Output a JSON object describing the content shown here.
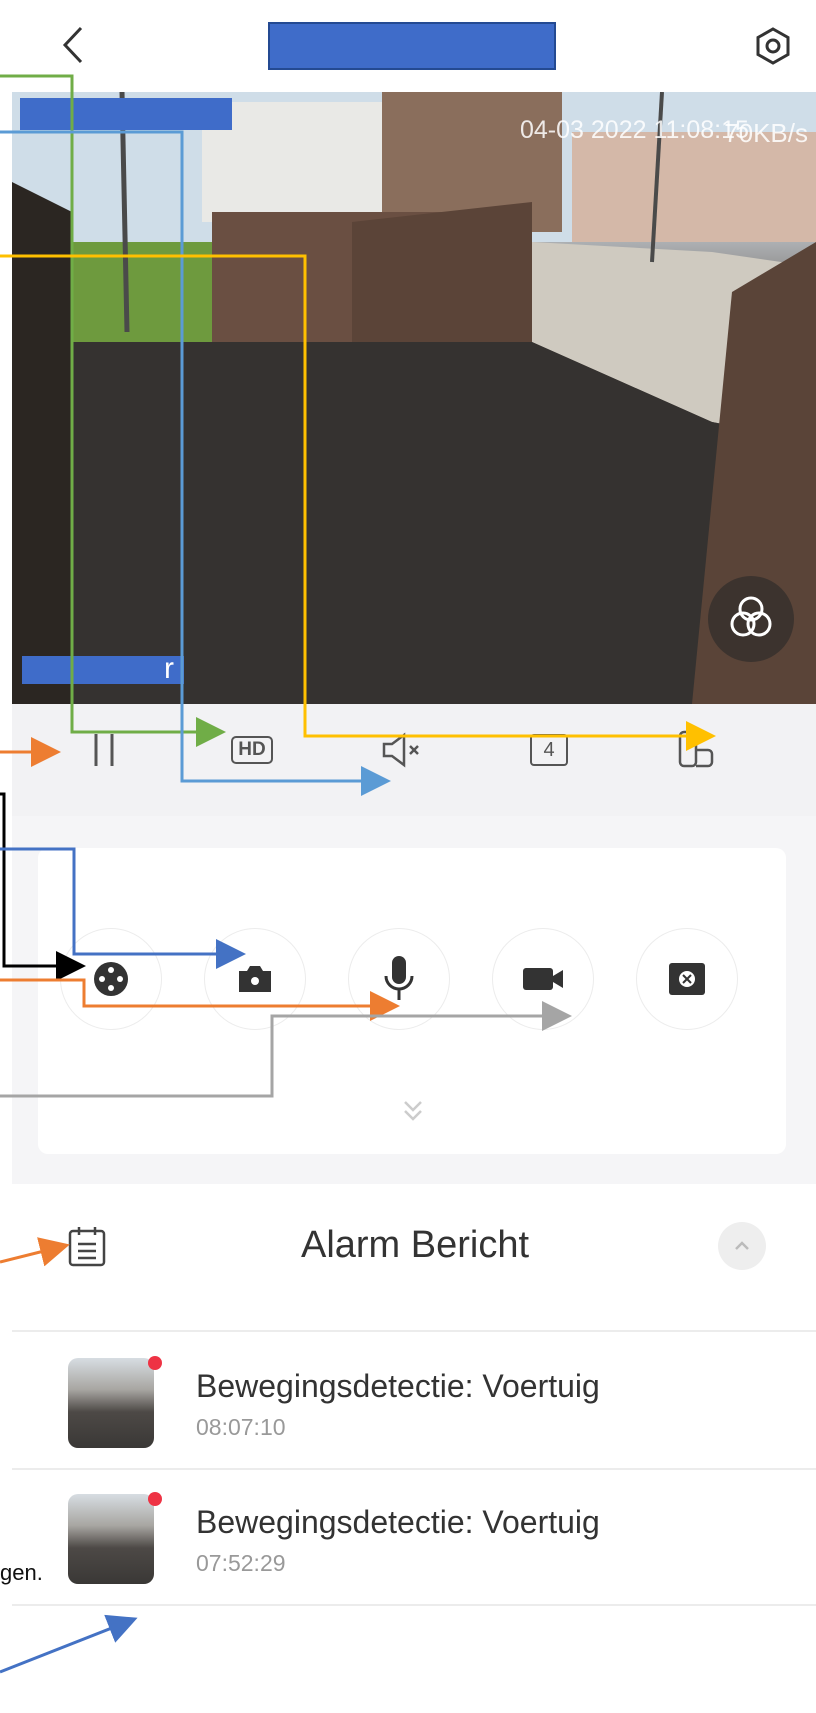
{
  "header": {
    "back_icon": "chevron-left-icon",
    "settings_icon": "gear-hexagon-icon"
  },
  "video": {
    "timestamp": "04-03 2022 11:08:15",
    "rate": "70KB/s",
    "camera_label": "r",
    "layers_icon": "three-circles-icon"
  },
  "controls": {
    "pause_icon": "pause-icon",
    "hd_label": "HD",
    "mute_icon": "speaker-muted-icon",
    "split_label": "4",
    "landscape_icon": "rotate-screen-icon"
  },
  "actions": [
    {
      "icon": "ptz-control-icon"
    },
    {
      "icon": "camera-snapshot-icon"
    },
    {
      "icon": "microphone-icon"
    },
    {
      "icon": "video-record-icon"
    },
    {
      "icon": "preset-target-icon"
    }
  ],
  "alarm": {
    "title": "Alarm Bericht",
    "items": [
      {
        "title": "Bewegingsdetectie: Voertuig",
        "time": "08:07:10"
      },
      {
        "title": "Bewegingsdetectie: Voertuig",
        "time": "07:52:29"
      }
    ]
  },
  "annotation_snippet": "gen.",
  "colors": {
    "accent_blue": "#3f6cc9",
    "arrow_green": "#70ad47",
    "arrow_orange": "#ed7d31",
    "arrow_yellow": "#ffc000",
    "arrow_gray": "#a5a5a5",
    "arrow_lightblue": "#5b9bd5",
    "unread_dot": "#ee3344"
  }
}
